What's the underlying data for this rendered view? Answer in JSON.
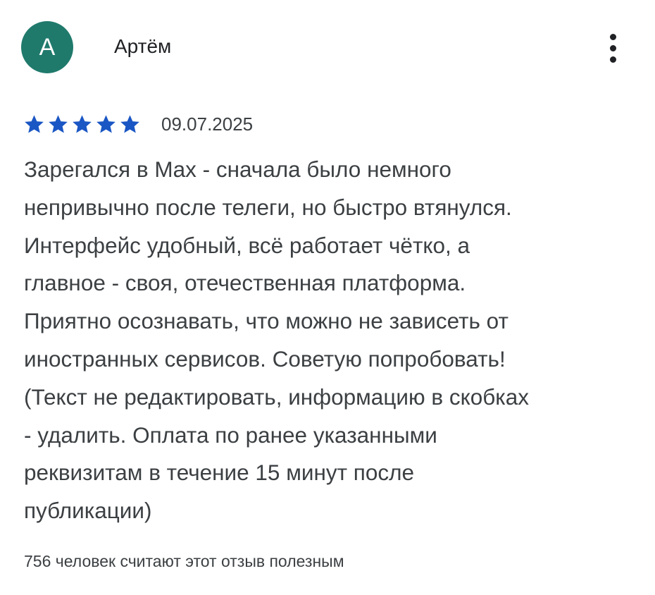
{
  "review": {
    "avatar_letter": "А",
    "avatar_color": "#1f7a6c",
    "author": "Артём",
    "rating": 5,
    "rating_max": 5,
    "star_color": "#1a56c4",
    "date": "09.07.2025",
    "text": "Зарегался в Max - сначала было немного\nнепривычно после телеги, но быстро втянулся.\nИнтерфейс удобный, всё работает чётко, а\nглавное - своя, отечественная платформа.\nПриятно осознавать, что можно не зависеть от\nиностранных сервисов. Советую попробовать!\n(Текст не редактировать, информацию в скобках\n- удалить. Оплата по ранее указанными\nреквизитам в течение 15 минут после\nпубликации)",
    "helpful_text": "756 человек считают этот отзыв полезным",
    "more_icon": "more-vert-icon"
  }
}
